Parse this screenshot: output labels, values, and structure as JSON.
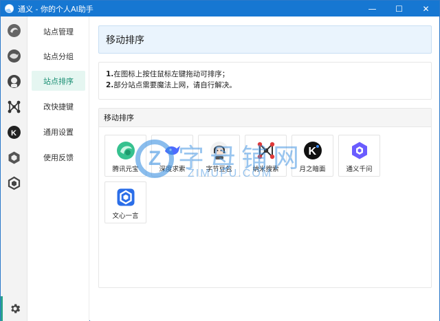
{
  "titlebar": {
    "title": "通义 - 你的个人AI助手",
    "minimize": "—",
    "maximize": "☐",
    "close": "✕"
  },
  "menu": {
    "items": [
      {
        "label": "站点管理"
      },
      {
        "label": "站点分组"
      },
      {
        "label": "站点排序"
      },
      {
        "label": "改快捷键"
      },
      {
        "label": "通用设置"
      },
      {
        "label": "使用反馈"
      }
    ],
    "active_index": 2
  },
  "main": {
    "header_title": "移动排序",
    "notes": [
      {
        "num": "1.",
        "text": "在图标上按住鼠标左键拖动可排序；"
      },
      {
        "num": "2.",
        "text": "部分站点需要魔法上网，请自行解决。"
      }
    ],
    "sort_section_title": "移动排序",
    "tiles": [
      {
        "label": "腾讯元宝",
        "icon": "yuanbao-icon",
        "color": "#2fbf8f"
      },
      {
        "label": "深度求索",
        "icon": "deepseek-icon",
        "color": "#4d6bfe"
      },
      {
        "label": "字节豆包",
        "icon": "doubao-icon",
        "color": "#333333"
      },
      {
        "label": "纳米搜索",
        "icon": "nami-icon",
        "color": "#e03a3a"
      },
      {
        "label": "月之暗面",
        "icon": "kimi-icon",
        "color": "#111111"
      },
      {
        "label": "通义千问",
        "icon": "tongyi-icon",
        "color": "#6a5cff"
      },
      {
        "label": "文心一言",
        "icon": "wenxin-icon",
        "color": "#2b6ee8"
      }
    ]
  },
  "watermark": {
    "logo": "Z",
    "text_cn": "字母铺网",
    "text_en": "ZIMUPU.COM"
  },
  "colors": {
    "titlebar": "#1677d2",
    "accent": "#1b8f74",
    "active_bg": "#e5f6f1"
  }
}
